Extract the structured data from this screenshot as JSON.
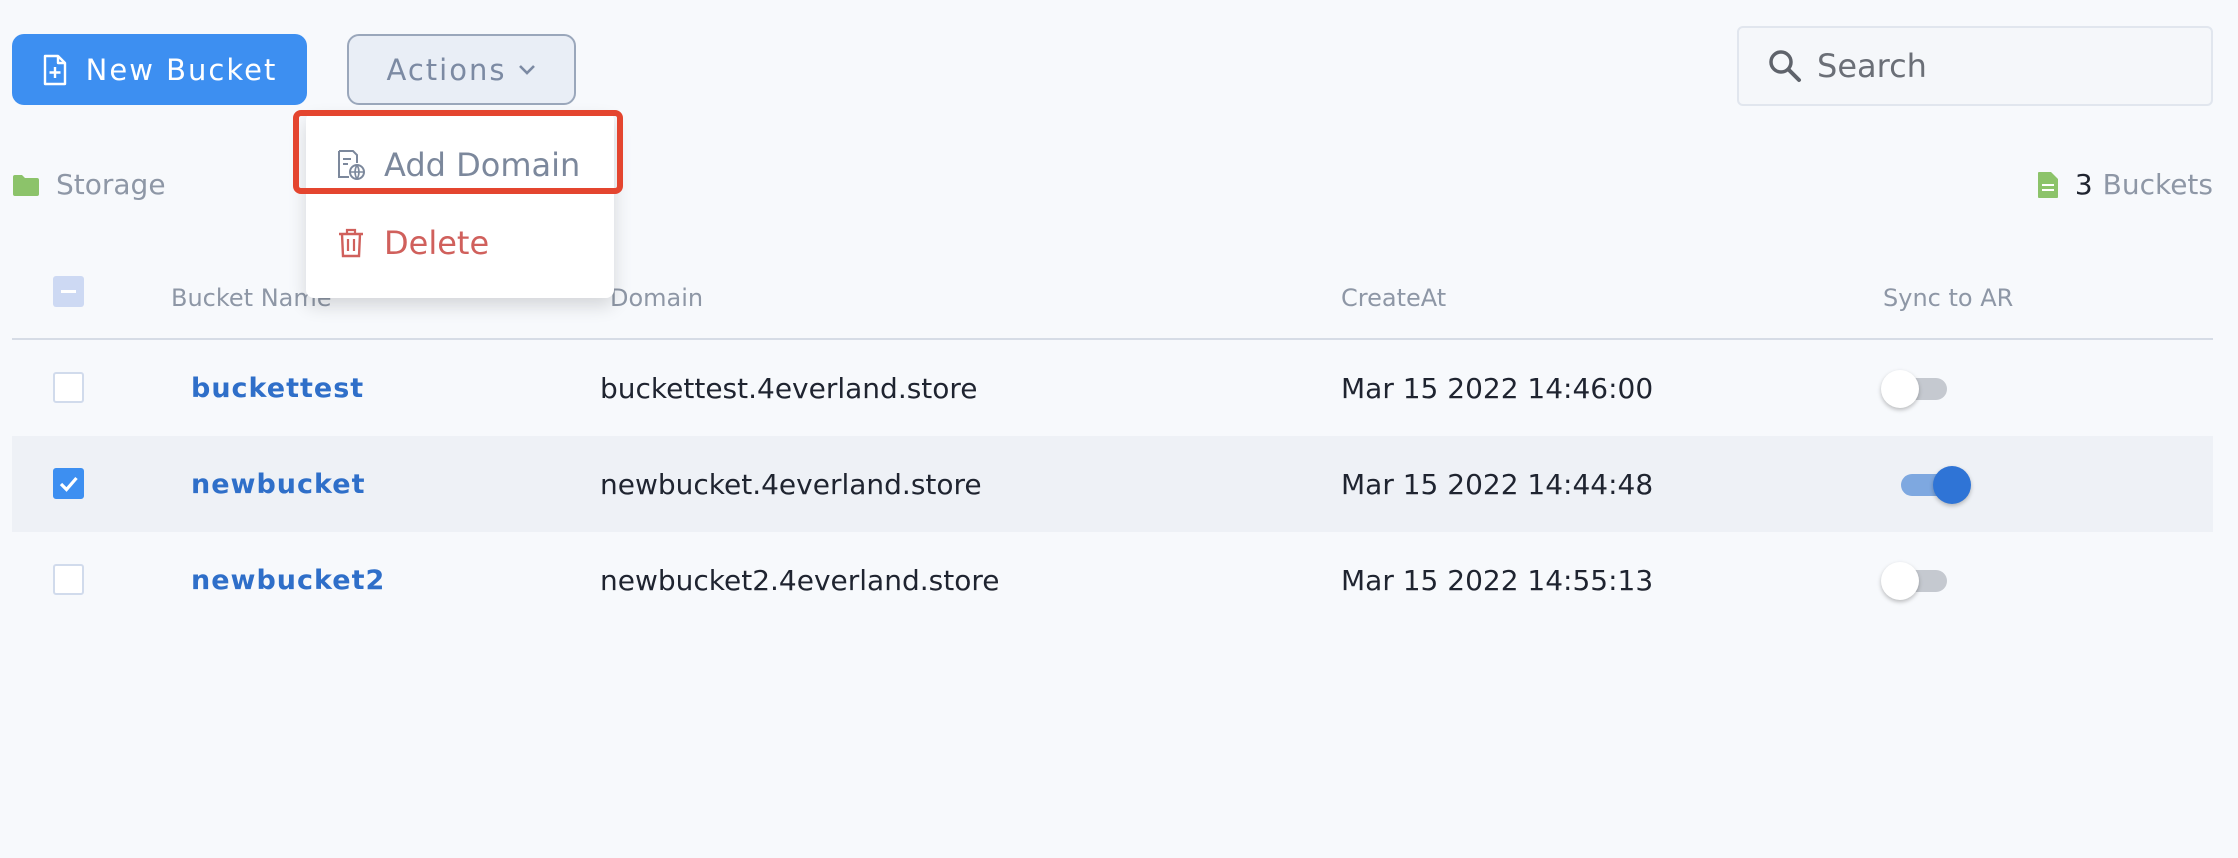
{
  "toolbar": {
    "new_bucket_label": "New Bucket",
    "actions_label": "Actions"
  },
  "search": {
    "placeholder": "Search"
  },
  "breadcrumb": {
    "label": "Storage"
  },
  "summary": {
    "count": "3",
    "unit": "Buckets"
  },
  "actions_menu": {
    "items": [
      {
        "label": "Add Domain",
        "icon": "add-domain-icon",
        "highlighted": true
      },
      {
        "label": "Delete",
        "icon": "trash-icon"
      }
    ]
  },
  "table": {
    "columns": [
      "Bucket Name",
      "Domain",
      "CreateAt",
      "Sync to AR"
    ],
    "rows": [
      {
        "name": "buckettest",
        "domain": "buckettest.4everland.store",
        "created": "Mar 15 2022 14:46:00",
        "checked": false,
        "sync": false
      },
      {
        "name": "newbucket",
        "domain": "newbucket.4everland.store",
        "created": "Mar 15 2022 14:44:48",
        "checked": true,
        "sync": true
      },
      {
        "name": "newbucket2",
        "domain": "newbucket2.4everland.store",
        "created": "Mar 15 2022 14:55:13",
        "checked": false,
        "sync": false
      }
    ]
  },
  "colors": {
    "primary": "#3d8ff1",
    "link": "#2f6fc9",
    "danger": "#d0605c",
    "highlight": "#e4452f",
    "folder": "#8cc36a"
  }
}
